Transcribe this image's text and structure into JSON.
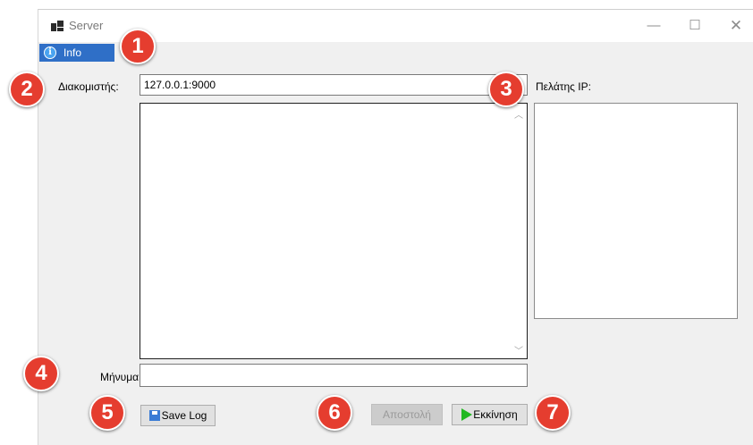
{
  "window": {
    "title": "Server",
    "minimize_glyph": "—",
    "maximize_glyph": "☐",
    "close_glyph": "✕"
  },
  "menu": {
    "info_label": "Info",
    "info_icon": "i"
  },
  "server": {
    "label": "Διακομιστής:",
    "value": "127.0.0.1:9000"
  },
  "client": {
    "label": "Πελάτης IP:"
  },
  "message": {
    "label": "Μήνυμα:",
    "value": ""
  },
  "buttons": {
    "save_log": "Save Log",
    "send": "Αποστολή",
    "start": "Εκκίνηση"
  },
  "scroll": {
    "up": "︿",
    "down": "﹀"
  },
  "badges": [
    "1",
    "2",
    "3",
    "4",
    "5",
    "6",
    "7"
  ],
  "colors": {
    "badge": "#e53d2f",
    "menu_highlight": "#2f6fc7",
    "start_icon": "#22b822"
  }
}
